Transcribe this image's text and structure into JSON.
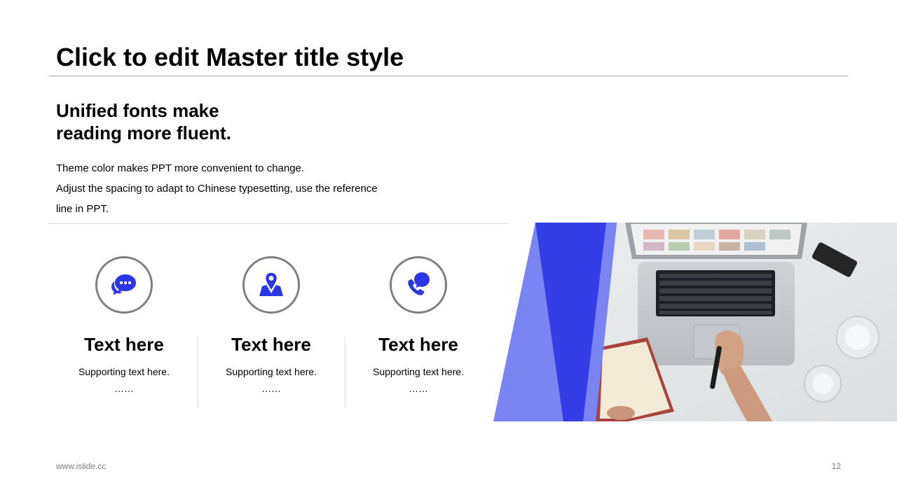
{
  "slide": {
    "title": "Click to edit Master title style",
    "subtitle_lines": [
      "Unified fonts make",
      "reading more fluent."
    ],
    "body_lines": [
      "Theme color makes PPT more convenient to change.",
      "Adjust the spacing to adapt to Chinese typesetting, use the reference",
      "line in PPT."
    ],
    "features": [
      {
        "icon": "chat-bubble-icon",
        "title": "Text here",
        "text": "Supporting text here.",
        "dots": "……"
      },
      {
        "icon": "map-pin-icon",
        "title": "Text here",
        "text": "Supporting text here.",
        "dots": "……"
      },
      {
        "icon": "phone-chat-icon",
        "title": "Text here",
        "text": "Supporting text here.",
        "dots": "……"
      }
    ],
    "photo_icon": "laptop-desk-photo",
    "footer": {
      "url": "www.islide.cc",
      "page_number": "12"
    }
  },
  "colors": {
    "accent": "#2b36e6",
    "accent_light": "#7a84f2",
    "icon_ring": "#7f7f7f",
    "rule": "#a6a6a6",
    "footer_text": "#7f7f7f"
  }
}
